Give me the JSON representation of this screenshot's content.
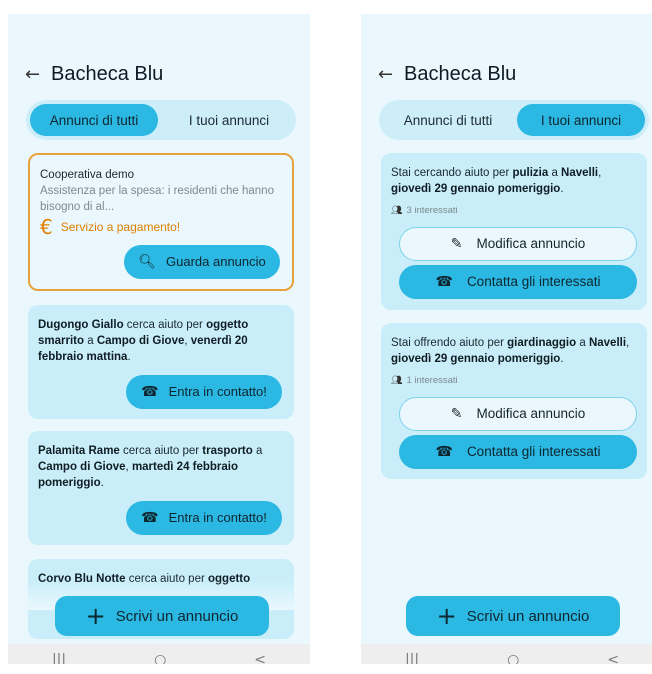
{
  "left": {
    "back_icon": "←",
    "title": "Bacheca Blu",
    "tabs": [
      "Annunci di tutti",
      "I tuoi annunci"
    ],
    "active_tab": 0,
    "cards": [
      {
        "org": "Cooperativa demo",
        "desc": "Assistenza per la spesa: i residenti che hanno bisogno di al...",
        "paid_label": "Servizio a pagamento!",
        "paid_icon": "€",
        "button": "Guarda annuncio",
        "button_icon": "search-icon"
      },
      {
        "name": "Dugongo Giallo",
        "t1": " cerca aiuto per ",
        "what": "oggetto smarrito",
        "t2": " a ",
        "place": "Campo di Giove",
        "t3": ", ",
        "when": "venerdì 20 febbraio mattina",
        "t4": ".",
        "button": "Entra in contatto!"
      },
      {
        "name": "Palamita Rame",
        "t1": " cerca aiuto per ",
        "what": "trasporto",
        "t2": " a ",
        "place": "Campo di Giove",
        "t3": ", ",
        "when": "martedì 24 febbraio pomeriggio",
        "t4": ".",
        "button": "Entra in contatto!"
      },
      {
        "name": "Corvo Blu Notte",
        "t1": " cerca aiuto per ",
        "what": "oggetto"
      }
    ],
    "fab_label": "Scrivi un annuncio"
  },
  "right": {
    "back_icon": "←",
    "title": "Bacheca Blu",
    "tabs": [
      "Annunci di tutti",
      "I tuoi annunci"
    ],
    "active_tab": 1,
    "cards": [
      {
        "t1": "Stai cercando aiuto per ",
        "what": "pulizia",
        "t2": " a ",
        "place": "Navelli",
        "t3": ", ",
        "when": "giovedì 29 gennaio pomeriggio",
        "t4": ".",
        "interested": "3 interessati",
        "edit": "Modifica annuncio",
        "contact": "Contatta gli interessati"
      },
      {
        "t1": "Stai offrendo aiuto per ",
        "what": "giardinaggio",
        "t2": " a ",
        "place": "Navelli",
        "t3": ", ",
        "when": "giovedì 29 gennaio pomeriggio",
        "t4": ".",
        "interested": "1 interessati",
        "edit": "Modifica annuncio",
        "contact": "Contatta gli interessati"
      }
    ],
    "fab_label": "Scrivi un annuncio"
  },
  "navbar": {
    "recents": "|||",
    "home": "○",
    "back": "<"
  },
  "colors": {
    "accent": "#2bb8e2",
    "card": "#c9eef9",
    "background": "#eaf8fd",
    "paid_border": "#e8a23c",
    "paid_text": "#e07f00"
  }
}
